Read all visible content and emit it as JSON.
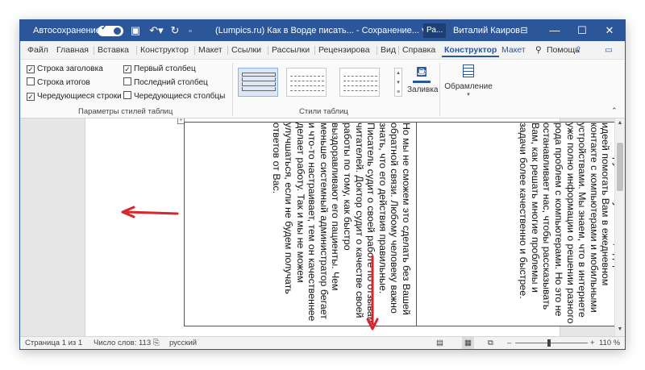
{
  "titlebar": {
    "autosave_label": "Автосохранение",
    "doc_title": "(Lumpics.ru) Как в Ворде писать... - Сохранение... ▾",
    "badge": "Ра...",
    "user": "Виталий Каиров",
    "background_color": "#2b579a"
  },
  "tabs": [
    {
      "label": "Файл"
    },
    {
      "label": "Главная"
    },
    {
      "label": "Вставка"
    },
    {
      "label": "Конструктор"
    },
    {
      "label": "Макет"
    },
    {
      "label": "Ссылки"
    },
    {
      "label": "Рассылки"
    },
    {
      "label": "Рецензирова"
    },
    {
      "label": "Вид"
    },
    {
      "label": "Справка"
    },
    {
      "label": "Конструктор"
    },
    {
      "label": "Макет"
    }
  ],
  "tell_me": "Помощь",
  "ribbon": {
    "options": [
      {
        "label": "Строка заголовка",
        "checked": true
      },
      {
        "label": "Строка итогов",
        "checked": false
      },
      {
        "label": "Чередующиеся строки",
        "checked": true
      },
      {
        "label": "Первый столбец",
        "checked": true
      },
      {
        "label": "Последний столбец",
        "checked": false
      },
      {
        "label": "Чередующиеся столбцы",
        "checked": false
      }
    ],
    "group_options_label": "Параметры стилей таблиц",
    "group_styles_label": "Стили таблиц",
    "shading_label": "Заливка",
    "borders_label": "Обрамление",
    "checkmark": "✓"
  },
  "document": {
    "cell_right": "Мы — группа энтузиастов, одержимых идеей помогать Вам в ежедневном контакте с компьютерами и мобильными устройствами. Мы знаем, что в интернете уже полно информации о решении разного рода проблем с компьютерами. Но это не останавливает нас, чтобы рассказывать Вам, как решать многие проблемы и задачи более качественно и быстрее.",
    "cell_left": "Но мы не сможем это сделать без Вашей обратной связи. Любому человеку важно знать, что его действия правильные. Писатель судит о своей работе по отзывам читателей. Доктор судит о качестве своей работы по тому, как быстро выздоравливают его пациенты. Чем меньше системный администратор бегает и что-то настраивает, тем он качественнее делает работу. Так и мы не можем улучшаться, если не будем получать ответов от Вас."
  },
  "statusbar": {
    "page": "Страница 1 из 1",
    "words": "Число слов: 113",
    "language": "русский",
    "zoom": "110 %",
    "zoom_percent": 110
  },
  "annotation_color": "#d9262b"
}
